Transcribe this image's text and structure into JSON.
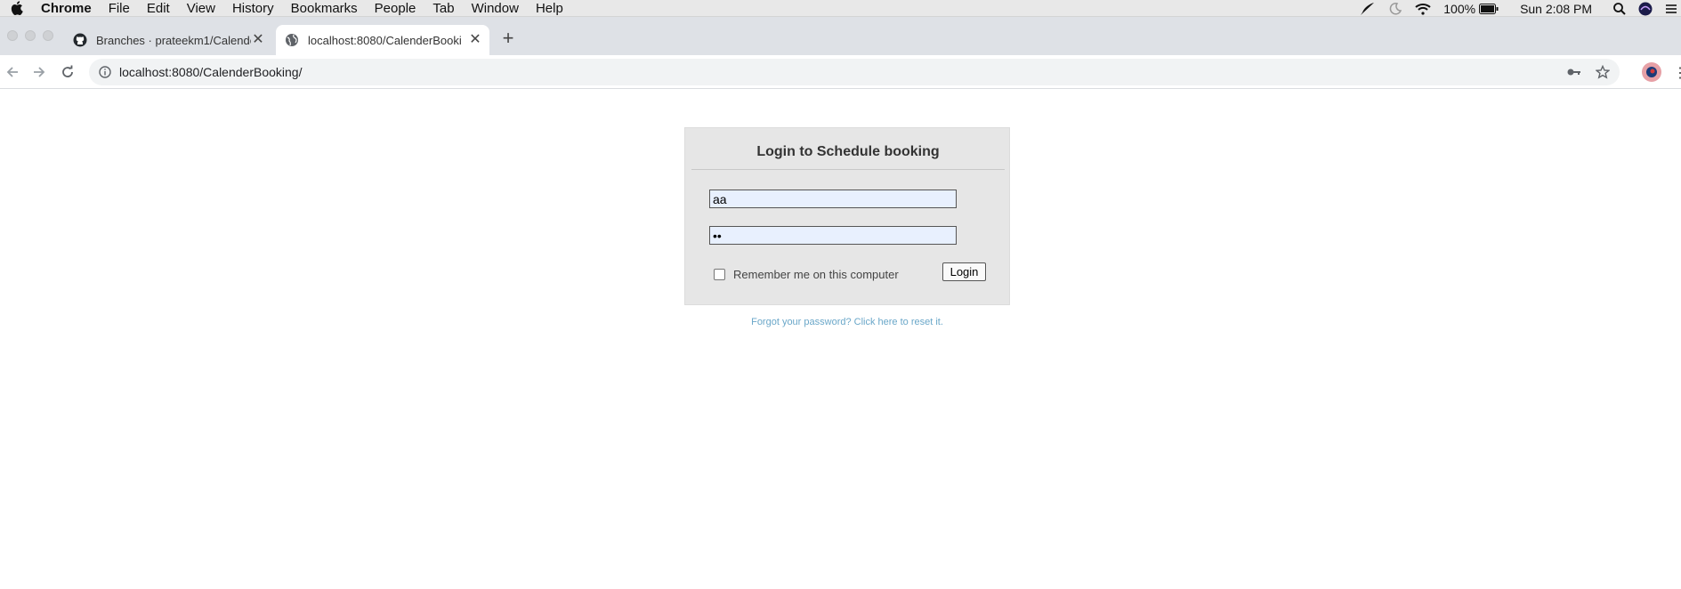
{
  "menubar": {
    "app_name": "Chrome",
    "items": [
      "File",
      "Edit",
      "View",
      "History",
      "Bookmarks",
      "People",
      "Tab",
      "Window",
      "Help"
    ],
    "battery": "100%",
    "clock": "Sun 2:08 PM"
  },
  "tabs": [
    {
      "title": "Branches · prateekm1/Calende",
      "icon": "github-icon"
    },
    {
      "title": "localhost:8080/CalenderBooki",
      "icon": "globe-icon"
    }
  ],
  "toolbar": {
    "url": "localhost:8080/CalenderBooking/"
  },
  "login": {
    "title": "Login to Schedule booking",
    "username_value": "aa",
    "password_value": "••",
    "remember_label": "Remember me on this computer",
    "login_button": "Login",
    "forgot_link": "Forgot your password? Click here to reset it."
  }
}
